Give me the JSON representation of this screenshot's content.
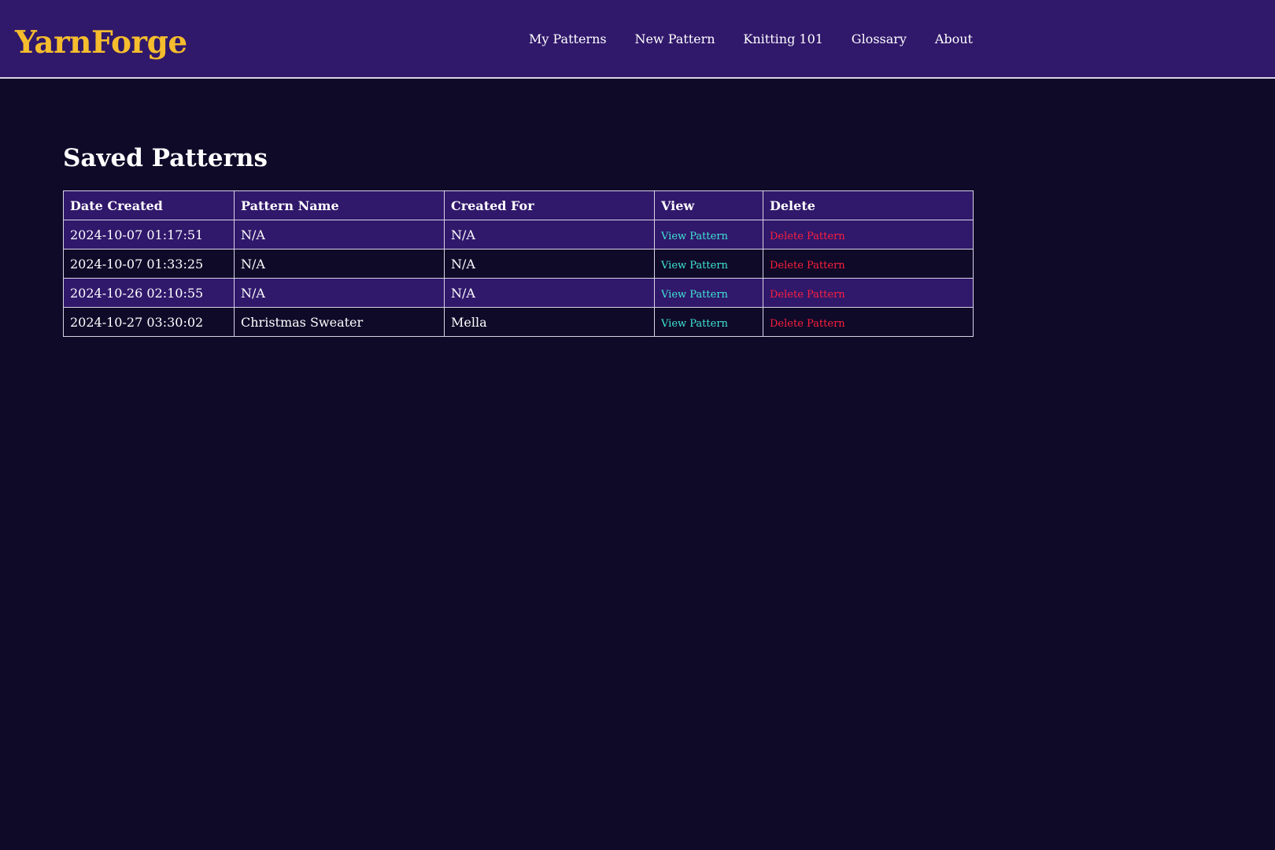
{
  "header": {
    "logo": "YarnForge",
    "nav": [
      {
        "label": "My Patterns"
      },
      {
        "label": "New Pattern"
      },
      {
        "label": "Knitting 101"
      },
      {
        "label": "Glossary"
      },
      {
        "label": "About"
      }
    ]
  },
  "main": {
    "title": "Saved Patterns",
    "table": {
      "columns": [
        "Date Created",
        "Pattern Name",
        "Created For",
        "View",
        "Delete"
      ],
      "rows": [
        {
          "date": "2024-10-07 01:17:51",
          "pattern_name": "N/A",
          "created_for": "N/A",
          "view_label": "View Pattern",
          "delete_label": "Delete Pattern"
        },
        {
          "date": "2024-10-07 01:33:25",
          "pattern_name": "N/A",
          "created_for": "N/A",
          "view_label": "View Pattern",
          "delete_label": "Delete Pattern"
        },
        {
          "date": "2024-10-26 02:10:55",
          "pattern_name": "N/A",
          "created_for": "N/A",
          "view_label": "View Pattern",
          "delete_label": "Delete Pattern"
        },
        {
          "date": "2024-10-27 03:30:02",
          "pattern_name": "Christmas Sweater",
          "created_for": "Mella",
          "view_label": "View Pattern",
          "delete_label": "Delete Pattern"
        }
      ]
    }
  },
  "colors": {
    "page_background": "#100a29",
    "header_background": "#30186b",
    "logo": "#f5bd2d",
    "view_link": "#3ee6d4",
    "delete_link": "#ff1f3d",
    "text": "#ffffff",
    "border": "#d8d4e6"
  }
}
